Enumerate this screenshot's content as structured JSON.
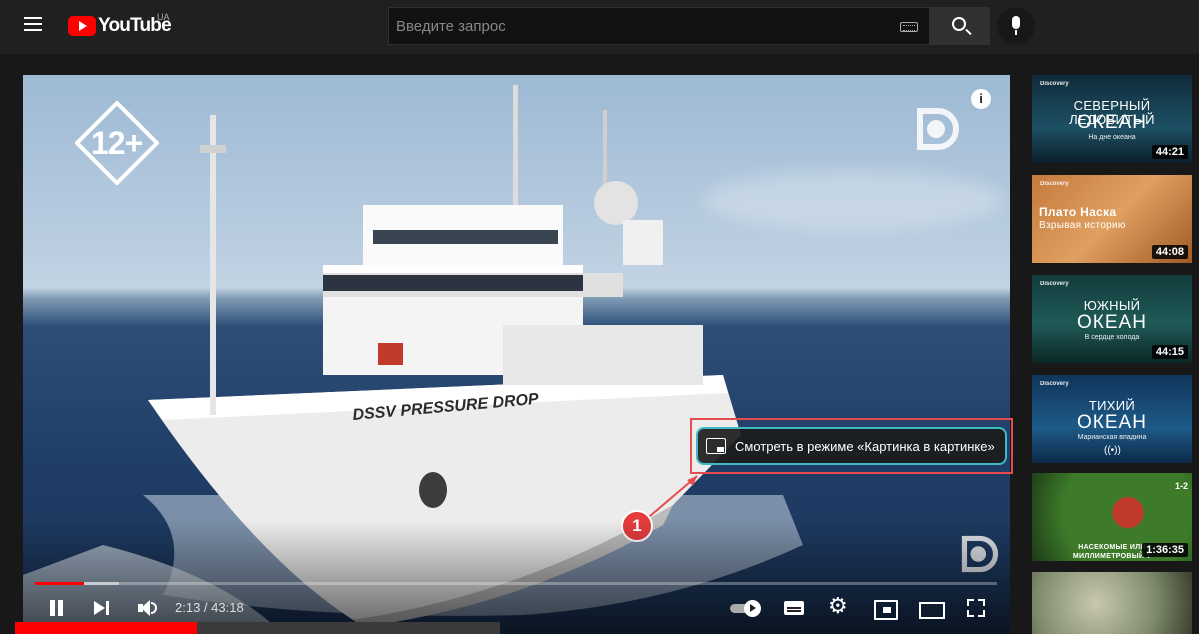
{
  "header": {
    "logo_text": "YouTube",
    "region": "UA",
    "search_placeholder": "Введите запрос"
  },
  "player": {
    "age_rating": "12+",
    "ship_name": "DSSV PRESSURE DROP",
    "pip_tooltip": "Смотреть в режиме «Картинка в картинке»",
    "callout_number": "1",
    "current_time": "2:13",
    "separator": " / ",
    "duration": "43:18",
    "played_fraction": 0.051,
    "buffered_fraction": 0.087,
    "info_glyph": "i"
  },
  "page_progress_fraction": 0.375,
  "colors": {
    "accent": "#ff0000",
    "tooltip_border": "#3fb9c4",
    "highlight": "#e74c4c"
  },
  "sidebar": {
    "items": [
      {
        "brand": "Discovery",
        "title": "СЕВЕРНЫЙ ЛЕДОВИТЫЙ",
        "title_big": "ОКЕАН",
        "subtitle": "На дне океана",
        "duration": "44:21"
      },
      {
        "brand": "Discovery",
        "title": "Плато Наска",
        "title2": "Взрывая историю",
        "duration": "44:08"
      },
      {
        "brand": "Discovery",
        "title": "ЮЖНЫЙ",
        "title_big": "ОКЕАН",
        "subtitle": "В сердце холода",
        "duration": "44:15"
      },
      {
        "brand": "Discovery",
        "title": "ТИХИЙ",
        "title_big": "ОКЕАН",
        "subtitle": "Марианская впадина",
        "live": "((•))"
      },
      {
        "title": "НАСЕКОМЫЕ ИЛИ",
        "title2": "МИЛЛИМЕТРОВЫЙ Т",
        "badge": "1-2",
        "duration": "1:36:35"
      },
      {}
    ]
  }
}
